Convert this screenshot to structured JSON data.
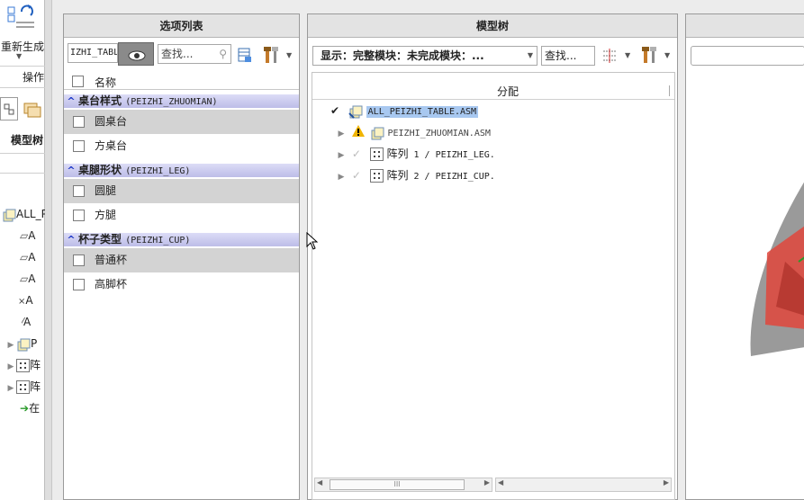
{
  "left": {
    "regenerate_label": "重新生成",
    "operations_label": "操作",
    "model_tree_label": "模型树",
    "tree_items": [
      "ALL_P",
      "A",
      "A",
      "A",
      "A",
      "A",
      "P",
      "阵",
      "阵",
      "在"
    ]
  },
  "options_panel": {
    "title": "选项列表",
    "filter_value": "IZHI_TABL",
    "search_placeholder": "查找...",
    "column_header": "名称",
    "groups": [
      {
        "label": "桌台样式",
        "code": "(PEIZHI_ZHUOMIAN)",
        "items": [
          "圆桌台",
          "方桌台"
        ]
      },
      {
        "label": "桌腿形状",
        "code": "(PEIZHI_LEG)",
        "items": [
          "圆腿",
          "方腿"
        ]
      },
      {
        "label": "杯子类型",
        "code": "(PEIZHI_CUP)",
        "items": [
          "普通杯",
          "高脚杯"
        ]
      }
    ]
  },
  "model_panel": {
    "title": "模型树",
    "display_select": "显示：完整模块：未完成模块：...",
    "search_placeholder": "查找...",
    "column_header": "分配",
    "tree": [
      {
        "name": "ALL_PEIZHI_TABLE.ASM",
        "status": "check"
      },
      {
        "name": "PEIZHI_ZHUOMIAN.ASM",
        "status": "warning"
      },
      {
        "prefix": "阵列",
        "name": " 1 / PEIZHI_LEG.",
        "status": "dimcheck"
      },
      {
        "prefix": "阵列",
        "name": " 2 / PEIZHI_CUP.",
        "status": "dimcheck"
      }
    ],
    "scroll_thumb_label": "III"
  },
  "colors": {
    "group_band": "#bdbde8",
    "group_caret": "#1a35c7",
    "selection": "#a8c8f0",
    "warning": "#f0b400",
    "preview_red": "#e0463c"
  }
}
